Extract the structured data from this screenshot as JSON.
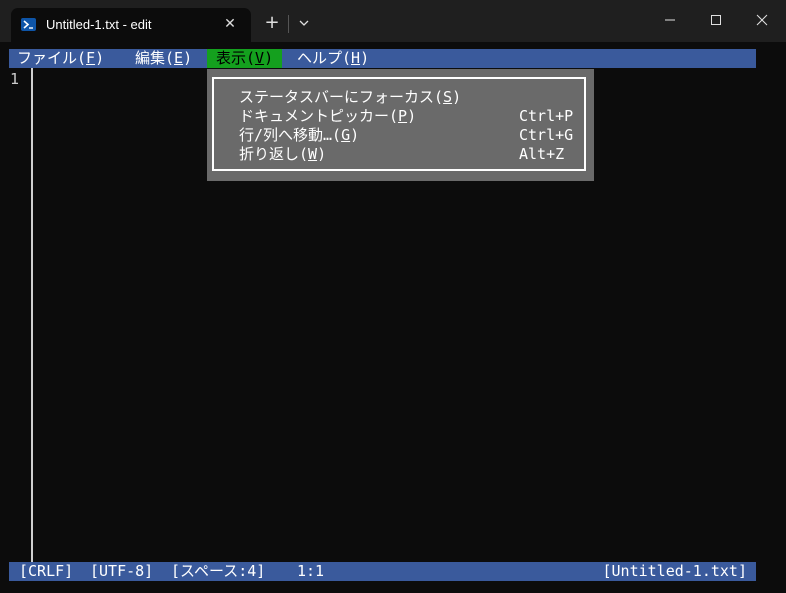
{
  "window": {
    "tab_title": "Untitled-1.txt - edit",
    "tab_icon": "powershell-icon",
    "accent_color": "#3a5a9c",
    "highlight_color": "#14a01e"
  },
  "menubar": {
    "file": {
      "text": "ファイル(",
      "key": "F",
      "close": ")"
    },
    "edit": {
      "text": "編集(",
      "key": "E",
      "close": ")"
    },
    "view": {
      "text": "表示(",
      "key": "V",
      "close": ")"
    },
    "help": {
      "text": "ヘルプ(",
      "key": "H",
      "close": ")"
    }
  },
  "editor": {
    "line_number": "1"
  },
  "view_menu": {
    "items": [
      {
        "text": "ステータスバーにフォーカス(",
        "key": "S",
        "close": ")",
        "shortcut": ""
      },
      {
        "text": "ドキュメントピッカー(",
        "key": "P",
        "close": ")",
        "shortcut": "Ctrl+P"
      },
      {
        "text": "行/列へ移動…(",
        "key": "G",
        "close": ")",
        "shortcut": "Ctrl+G"
      },
      {
        "text": "折り返し(",
        "key": "W",
        "close": ")",
        "shortcut": "Alt+Z"
      }
    ]
  },
  "statusbar": {
    "line_ending": "[CRLF]",
    "encoding": "[UTF-8]",
    "indent": "[スペース:4]",
    "cursor": "1:1",
    "filename": "[Untitled-1.txt]"
  }
}
